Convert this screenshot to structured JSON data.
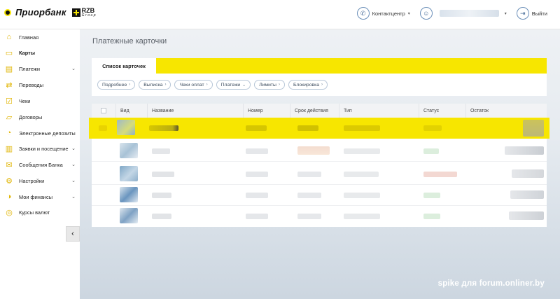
{
  "header": {
    "logo_text": "Приорбанк",
    "group_top": "RZB",
    "group_bottom": "Group",
    "contact_label": "Контактцентр",
    "logout_label": "Выйти"
  },
  "sidebar": {
    "items": [
      {
        "label": "Главная",
        "icon": "home-icon"
      },
      {
        "label": "Карты",
        "icon": "card-icon",
        "active": true
      },
      {
        "label": "Платежи",
        "icon": "wallet-icon",
        "expandable": true
      },
      {
        "label": "Переводы",
        "icon": "transfer-icon"
      },
      {
        "label": "Чеки",
        "icon": "check-icon"
      },
      {
        "label": "Договоры",
        "icon": "folder-icon"
      },
      {
        "label": "Электронные депозиты",
        "icon": "piggy-icon"
      },
      {
        "label": "Заявки и посещение",
        "icon": "request-icon",
        "expandable": true
      },
      {
        "label": "Сообщения Банка",
        "icon": "message-icon",
        "expandable": true
      },
      {
        "label": "Настройки",
        "icon": "gear-icon",
        "expandable": true
      },
      {
        "label": "Мои финансы",
        "icon": "finance-icon",
        "expandable": true
      },
      {
        "label": "Курсы валют",
        "icon": "currency-icon"
      }
    ],
    "collapse_glyph": "‹"
  },
  "main": {
    "page_title": "Платежные карточки",
    "tab_label": "Список карточек",
    "filters": [
      {
        "label": "Подробнее",
        "caret": "›"
      },
      {
        "label": "Выписка",
        "caret": "›"
      },
      {
        "label": "Чеки оплат",
        "caret": "›"
      },
      {
        "label": "Платежи",
        "caret": "⌄"
      },
      {
        "label": "Лимиты",
        "caret": "›"
      },
      {
        "label": "Блокировка",
        "caret": "›"
      }
    ],
    "columns": [
      "Вид",
      "Название",
      "Номер",
      "Срок действия",
      "Тип",
      "Статус",
      "Остаток"
    ]
  },
  "watermark": "spike для forum.onliner.by",
  "colors": {
    "accent_yellow": "#f7e600",
    "link_blue": "#4a6e9a"
  }
}
